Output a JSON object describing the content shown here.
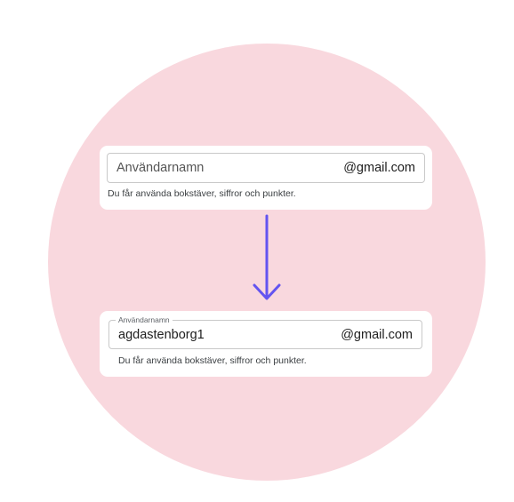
{
  "before": {
    "username_placeholder": "Användarnamn",
    "domain_suffix": "@gmail.com",
    "helper_text": "Du får använda bokstäver, siffror och punkter."
  },
  "after": {
    "username_label": "Användarnamn",
    "username_value": "agdastenborg1",
    "domain_suffix": "@gmail.com",
    "helper_text": "Du får använda bokstäver, siffror och punkter."
  },
  "colors": {
    "background_circle": "#f9d8de",
    "arrow": "#6354f0",
    "field_border": "#c9c9c9"
  },
  "icons": {
    "transition": "arrow-down-icon"
  }
}
